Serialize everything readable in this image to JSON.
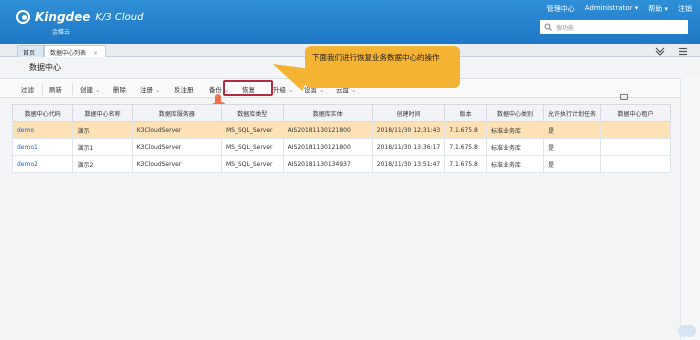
{
  "header": {
    "brand": "Kingdee",
    "product": "K/3 Cloud",
    "brand_sub": "金蝶云",
    "nav": [
      "管理中心",
      "Administrator",
      "帮助",
      "注销"
    ],
    "search_placeholder": "搜功能"
  },
  "tabs": {
    "home": "首页",
    "active": "数据中心列表"
  },
  "page": {
    "title": "数据中心"
  },
  "toolbar": {
    "items": [
      "过滤",
      "刷新",
      "创建",
      "删除",
      "注册",
      "反注册",
      "备份",
      "恢复",
      "升级",
      "设置",
      "云盘"
    ]
  },
  "callout": {
    "text": "下面我们进行恢复业务数据中心的操作"
  },
  "table": {
    "headers": [
      "数据中心代码",
      "数据中心名称",
      "数据库服务器",
      "数据库类型",
      "数据库实体",
      "创建时间",
      "版本",
      "数据中心类别",
      "允许执行计划任务",
      "数据中心租户"
    ],
    "rows": [
      [
        "demo",
        "演示",
        "K3CloudServer",
        "MS_SQL_Server",
        "AIS20181130121800",
        "2018/11/30 12:31:43",
        "7.1.675.8",
        "标准业务库",
        "是",
        ""
      ],
      [
        "demo1",
        "演示1",
        "K3CloudServer",
        "MS_SQL_Server",
        "AIS20181130121800",
        "2018/11/30 13:36:17",
        "7.1.675.8",
        "标准业务库",
        "是",
        ""
      ],
      [
        "demo2",
        "演示2",
        "K3CloudServer",
        "MS_SQL_Server",
        "AIS20181130134937",
        "2018/11/30 13:51:47",
        "7.1.675.8",
        "标准业务库",
        "是",
        ""
      ]
    ]
  },
  "colors": {
    "header_blue": "#1f78c6",
    "selected_row": "#ffe1b6",
    "callout": "#f5b333",
    "highlight_red": "#b32b3f"
  }
}
